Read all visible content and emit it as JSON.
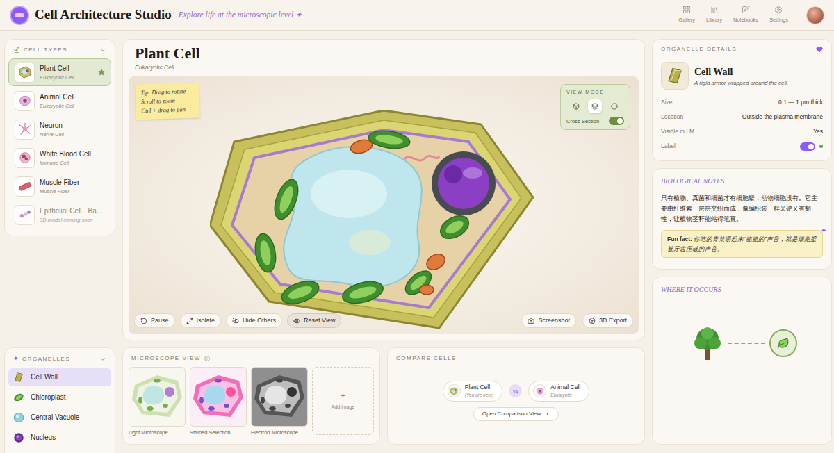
{
  "header": {
    "title": "Cell Architecture Studio",
    "subtitle": "Explore life at the microscopic level ✦",
    "nav": [
      {
        "label": "Gallery",
        "kind": "grid"
      },
      {
        "label": "Library",
        "kind": "library"
      },
      {
        "label": "Notebooks",
        "kind": "notebook"
      },
      {
        "label": "Settings",
        "kind": "settings"
      }
    ]
  },
  "cell_types": {
    "title": "CELL TYPES",
    "expanded": true,
    "items": [
      {
        "name": "Plant Cell",
        "sub": "Eukaryotic Cell",
        "kind": "plant",
        "selected": true,
        "starred": true,
        "disabled": false
      },
      {
        "name": "Animal Cell",
        "sub": "Eukaryotic Cell",
        "kind": "animal",
        "selected": false,
        "starred": false,
        "disabled": false
      },
      {
        "name": "Neuron",
        "sub": "Nerve Cell",
        "kind": "neuron",
        "selected": false,
        "starred": false,
        "disabled": false
      },
      {
        "name": "White Blood Cell",
        "sub": "Immune Cell",
        "kind": "wbc",
        "selected": false,
        "starred": false,
        "disabled": false
      },
      {
        "name": "Muscle Fiber",
        "sub": "Muscle Fiber",
        "kind": "muscle",
        "selected": false,
        "starred": false,
        "disabled": false
      },
      {
        "name": "Epithelial Cell · Ba…",
        "sub": "3D model coming soon",
        "kind": "epithelial",
        "selected": false,
        "starred": false,
        "disabled": true
      }
    ]
  },
  "viewer": {
    "title": "Plant Cell",
    "subtitle": "Eukaryotic Cell",
    "tip": [
      "Tip: Drag to rotate",
      "Scroll to zoom",
      "Ctrl + drag to pan"
    ],
    "view_mode": {
      "label": "VIEW MODE",
      "modes": [
        {
          "kind": "solid",
          "selected": false
        },
        {
          "kind": "layers",
          "selected": true
        },
        {
          "kind": "outline",
          "selected": false
        }
      ],
      "cross_section": {
        "label": "Cross-Section",
        "on": true
      }
    },
    "tools": [
      {
        "label": "Pause",
        "kind": "pause",
        "selected": false
      },
      {
        "label": "Isolate",
        "kind": "isolate",
        "selected": false
      },
      {
        "label": "Hide Others",
        "kind": "hide",
        "selected": false
      },
      {
        "label": "Reset View",
        "kind": "reset",
        "selected": true
      }
    ],
    "actions": [
      {
        "label": "Screenshot",
        "kind": "camera"
      },
      {
        "label": "3D Export",
        "kind": "box"
      }
    ]
  },
  "organelles": {
    "title": "ORGANELLES",
    "icon": "✦",
    "expanded": true,
    "items": [
      {
        "name": "Cell Wall",
        "kind": "wall",
        "selected": true
      },
      {
        "name": "Chloroplast",
        "kind": "chloroplast",
        "selected": false
      },
      {
        "name": "Central Vacuole",
        "kind": "vacuole",
        "selected": false
      },
      {
        "name": "Nucleus",
        "kind": "nucleus",
        "selected": false
      }
    ]
  },
  "microscope": {
    "title": "MICROSCOPE VIEW",
    "images": [
      {
        "caption": "Light Microscope",
        "kind": "light"
      },
      {
        "caption": "Stained Selection",
        "kind": "stained"
      },
      {
        "caption": "Electron Microscope",
        "kind": "electron"
      }
    ],
    "add": {
      "icon": "+",
      "label": "Add image"
    }
  },
  "compare": {
    "title": "COMPARE CELLS",
    "left": {
      "name": "Plant Cell",
      "sub": "(You are here)",
      "kind": "plant"
    },
    "vs": "vs",
    "right": {
      "name": "Animal Cell",
      "sub": "Eukaryotic",
      "kind": "animal"
    },
    "button": "Open Comparison View"
  },
  "details": {
    "title": "ORGANELLE DETAILS",
    "favorite": true,
    "name": "Cell Wall",
    "description": "A rigid armor wrapped around the cell.",
    "rows": [
      {
        "label": "Size",
        "value": "0.1 — 1 µm thick"
      },
      {
        "label": "Location",
        "value": "Outside the plasma membrane"
      },
      {
        "label": "Visible in LM",
        "value": "Yes"
      }
    ],
    "label_toggle": {
      "label": "Label",
      "on": true
    }
  },
  "notes": {
    "title": "BIOLOGICAL NOTES",
    "text": "只有植物、真菌和细菌才有细胞壁，动物细胞没有。它主要由纤维素一层层交织而成，像编织袋一样又硬又有韧性，让植物茎秆能站得笔直。",
    "fun_fact_label": "Fun fact:",
    "fun_fact": "你吃的青菜嚼起来“脆脆的”声音，就是细胞壁被牙齿压破的声音。",
    "sparkle": "✦"
  },
  "occurs": {
    "title": "WHERE IT OCCURS"
  }
}
